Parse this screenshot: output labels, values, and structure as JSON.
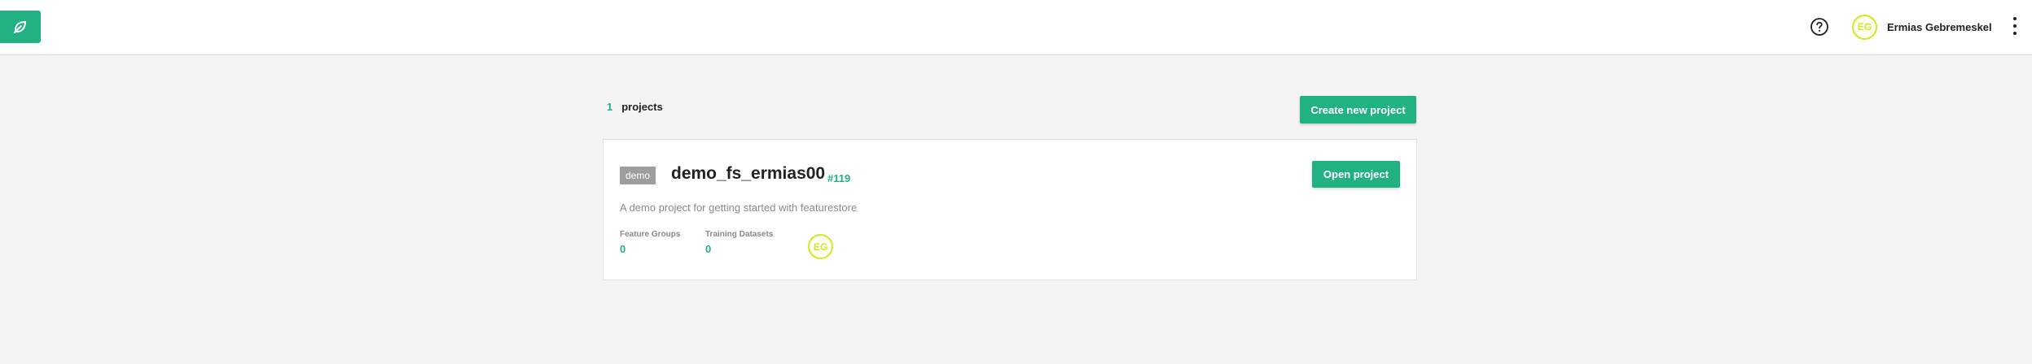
{
  "header": {
    "logo_icon": "leaf-logo-icon",
    "help_icon": "question-circle-icon",
    "user": {
      "initials": "EG",
      "name": "Ermias Gebremeskel"
    },
    "menu_icon": "kebab-menu-icon"
  },
  "projects": {
    "count": "1",
    "count_label": "projects",
    "create_button": "Create new project",
    "list": [
      {
        "tag": "demo",
        "name": "demo_fs_ermias00",
        "id": "#119",
        "open_button": "Open project",
        "description": "A demo project for getting started with featurestore",
        "stats": [
          {
            "label": "Feature Groups",
            "value": "0"
          },
          {
            "label": "Training Datasets",
            "value": "0"
          }
        ],
        "members": [
          {
            "initials": "EG"
          }
        ]
      }
    ]
  },
  "colors": {
    "accent": "#21b182",
    "avatar_ring": "#c9ec2b",
    "tag_bg": "#9e9e9e",
    "background": "#f4f4f4"
  }
}
